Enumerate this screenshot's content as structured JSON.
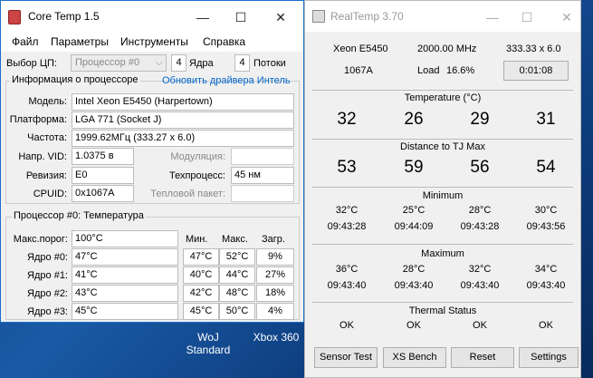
{
  "coretemp": {
    "title": "Core Temp 1.5",
    "menu": [
      "Файл",
      "Параметры",
      "Инструменты",
      "Справка"
    ],
    "cpu_select_label": "Выбор ЦП:",
    "cpu_select_value": "Процессор #0",
    "cores_count": "4",
    "cores_label": "Ядра",
    "threads_count": "4",
    "threads_label": "Потоки",
    "info_group_title": "Информация о процессоре",
    "update_link": "Обновить драйвера Интель",
    "model_label": "Модель:",
    "model_value": "Intel Xeon E5450 (Harpertown)",
    "platform_label": "Платформа:",
    "platform_value": "LGA 771 (Socket J)",
    "freq_label": "Частота:",
    "freq_value": "1999.62МГц (333.27 x 6.0)",
    "vid_label": "Напр. VID:",
    "vid_value": "1.0375 в",
    "modulation_label": "Модуляция:",
    "revision_label": "Ревизия:",
    "revision_value": "E0",
    "process_label": "Техпроцесс:",
    "process_value": "45 нм",
    "cpuid_label": "CPUID:",
    "cpuid_value": "0x1067A",
    "tdp_label": "Тепловой пакет:",
    "temp_group_title": "Процессор #0: Температура",
    "maxthr_label": "Макс.порог:",
    "maxthr_value": "100°C",
    "col_min": "Мин.",
    "col_max": "Макс.",
    "col_load": "Загр.",
    "cores": [
      {
        "label": "Ядро #0:",
        "temp": "47°C",
        "min": "47°C",
        "max": "52°C",
        "load": "9%"
      },
      {
        "label": "Ядро #1:",
        "temp": "41°C",
        "min": "40°C",
        "max": "44°C",
        "load": "27%"
      },
      {
        "label": "Ядро #2:",
        "temp": "43°C",
        "min": "42°C",
        "max": "48°C",
        "load": "18%"
      },
      {
        "label": "Ядро #3:",
        "temp": "45°C",
        "min": "45°C",
        "max": "50°C",
        "load": "4%"
      }
    ]
  },
  "realtemp": {
    "title": "RealTemp 3.70",
    "cpu_name": "Xeon E5450",
    "mhz": "2000.00 MHz",
    "multiplier": "333.33 x 6.0",
    "vid": "1067A",
    "load_label": "Load",
    "load_value": "16.6%",
    "timer": "0:01:08",
    "temperature_title": "Temperature (°C)",
    "temps": [
      "32",
      "26",
      "29",
      "31"
    ],
    "distance_title": "Distance to TJ Max",
    "distances": [
      "53",
      "59",
      "56",
      "54"
    ],
    "minimum_title": "Minimum",
    "min_temps": [
      "32°C",
      "25°C",
      "28°C",
      "30°C"
    ],
    "min_times": [
      "09:43:28",
      "09:44:09",
      "09:43:28",
      "09:43:56"
    ],
    "maximum_title": "Maximum",
    "max_temps": [
      "36°C",
      "28°C",
      "32°C",
      "34°C"
    ],
    "max_times": [
      "09:43:40",
      "09:43:40",
      "09:43:40",
      "09:43:40"
    ],
    "thermal_title": "Thermal Status",
    "thermal": [
      "OK",
      "OK",
      "OK",
      "OK"
    ],
    "buttons": {
      "sensor": "Sensor Test",
      "xs": "XS Bench",
      "reset": "Reset",
      "settings": "Settings"
    }
  },
  "desktop": {
    "icon1_line1": "WoJ",
    "icon1_line2": "Standard",
    "icon2_label": "Xbox 360"
  }
}
